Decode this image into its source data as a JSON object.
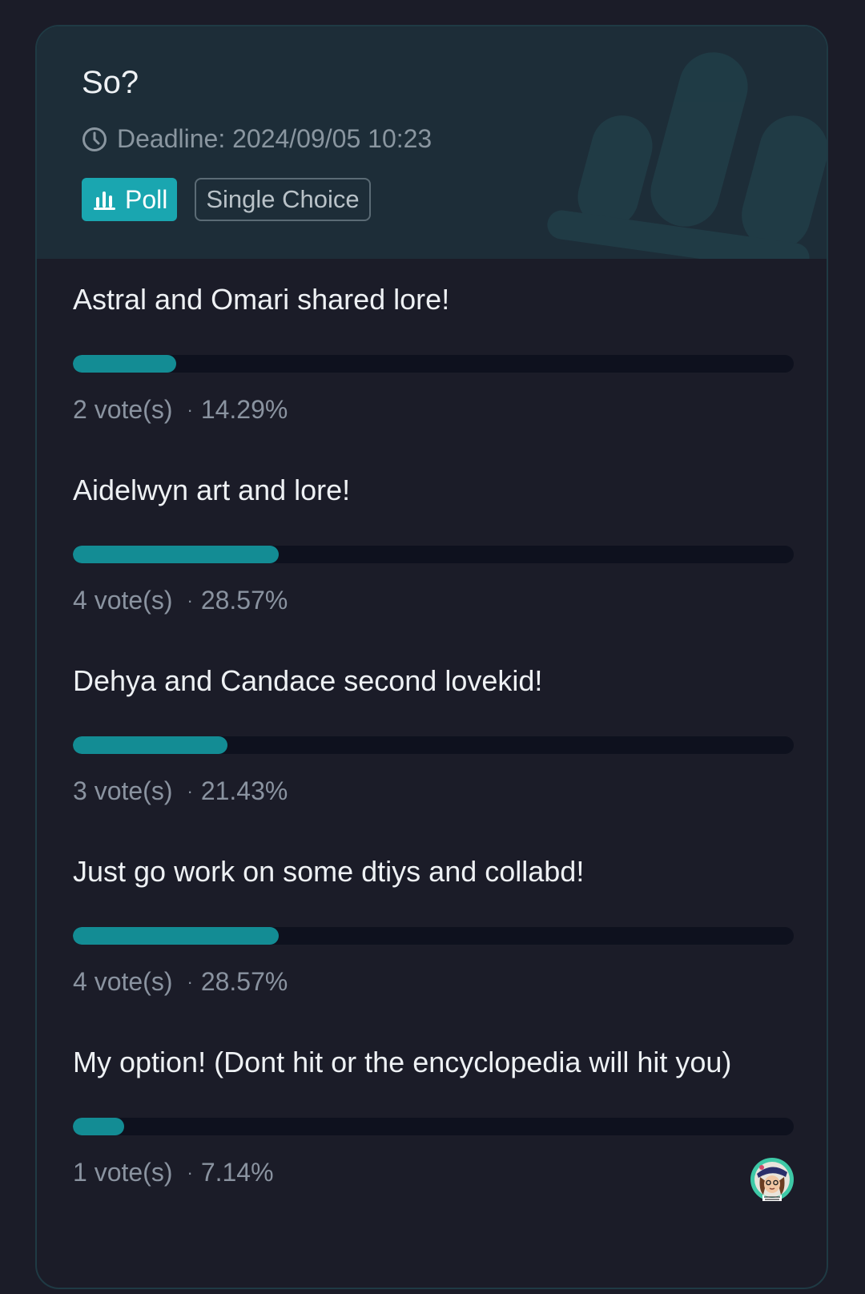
{
  "poll": {
    "title": "So?",
    "deadline": "Deadline: 2024/09/05 10:23",
    "tag_poll": "Poll",
    "tag_choice": "Single Choice"
  },
  "options": [
    {
      "label": "Astral and Omari shared lore!",
      "votes": "2 vote(s)",
      "percent": "14.29%",
      "fraction": 0.1429
    },
    {
      "label": "Aidelwyn art and lore!",
      "votes": "4 vote(s)",
      "percent": "28.57%",
      "fraction": 0.2857
    },
    {
      "label": "Dehya and Candace second lovekid!",
      "votes": "3 vote(s)",
      "percent": "21.43%",
      "fraction": 0.2143
    },
    {
      "label": "Just go work on some dtiys and collabd!",
      "votes": "4 vote(s)",
      "percent": "28.57%",
      "fraction": 0.2857
    },
    {
      "label": "My option! (Dont hit or the encyclopedia will hit you)",
      "votes": "1 vote(s)",
      "percent": "7.14%",
      "fraction": 0.0714,
      "has_voter_avatar": true
    }
  ],
  "colors": {
    "accent": "#1aa6b0",
    "bar_fill": "#138c94",
    "bar_track": "#0e111e"
  },
  "icons": {
    "deadline": "clock-icon",
    "poll_tag": "bar-chart-icon",
    "voter": "avatar"
  }
}
